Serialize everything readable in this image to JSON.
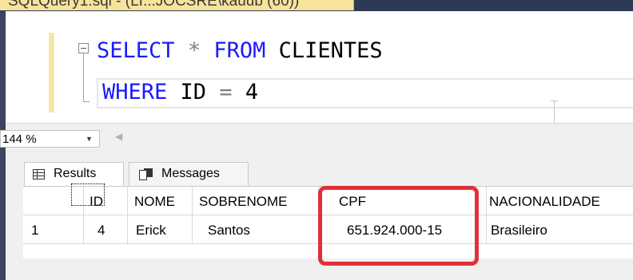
{
  "tab": {
    "title": "SQLQuery1.sql - (LI...JOCSRE\\kauub (60))",
    "close": "× ×"
  },
  "editor": {
    "line1": {
      "kw1": "SELECT",
      "star": "*",
      "kw2": "FROM",
      "table": "CLIENTES"
    },
    "line2": {
      "kw": "WHERE",
      "col": "ID",
      "op": "=",
      "val": "4"
    }
  },
  "zoom": {
    "value": "144 %"
  },
  "results_tabs": [
    {
      "label": "Results",
      "icon": "grid-icon"
    },
    {
      "label": "Messages",
      "icon": "messages-icon"
    }
  ],
  "grid": {
    "columns": [
      "",
      "ID",
      "NOME",
      "SOBRENOME",
      "CPF",
      "NACIONALIDADE"
    ],
    "rows": [
      [
        "1",
        "4",
        "Erick",
        "Santos",
        "651.924.000-15",
        "Brasileiro"
      ]
    ]
  },
  "colors": {
    "keyword": "#1a1aff",
    "highlight": "#e0313a",
    "tab_gold": "#f7e39a"
  }
}
